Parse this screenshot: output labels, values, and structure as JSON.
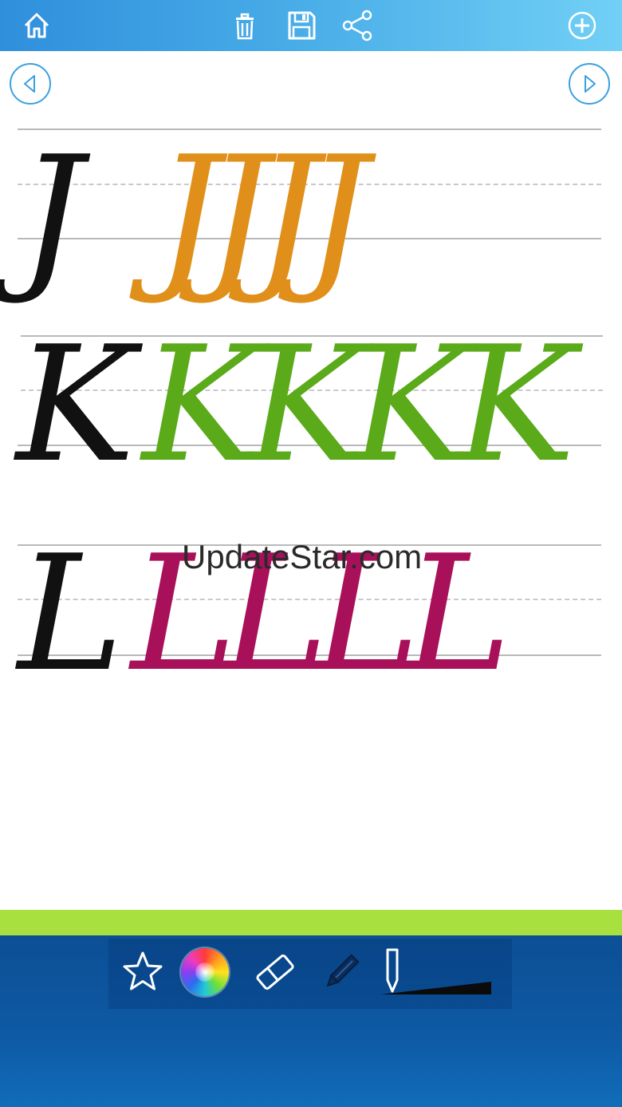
{
  "toolbar": {
    "icons": [
      "home-icon",
      "trash-icon",
      "save-icon",
      "share-icon",
      "add-icon"
    ]
  },
  "nav": {
    "icons": [
      "previous-icon",
      "next-icon"
    ]
  },
  "lines": [
    {
      "model": "J",
      "trace": "JJJJ",
      "trace_color": "#e0901a"
    },
    {
      "model": "K",
      "trace": "KKKK",
      "trace_color": "#5aaa1a"
    },
    {
      "model": "L",
      "trace": "LLLL",
      "trace_color": "#a8105a"
    }
  ],
  "watermark": "UpdateStar.com",
  "tools": {
    "icons": [
      "star-icon",
      "color-wheel-icon",
      "eraser-icon",
      "pencil-icon",
      "brush-size-icon"
    ],
    "colors": {
      "accent_green": "#a8e040",
      "bottom_bar": "#0e5aa5",
      "top_bar": "#4aaee8"
    }
  }
}
